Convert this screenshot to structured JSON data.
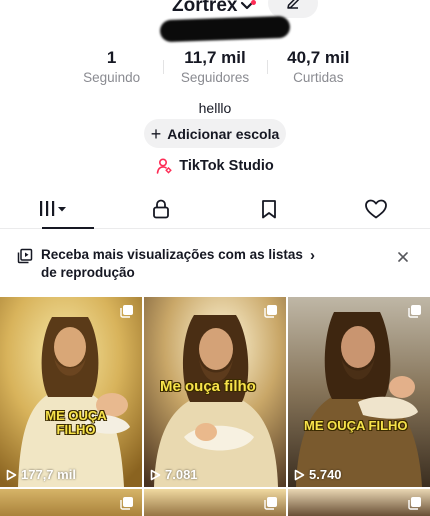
{
  "profile": {
    "username": "Zortrex",
    "bio": "helllo",
    "add_school_label": "Adicionar escola",
    "studio_label": "TikTok Studio"
  },
  "stats": [
    {
      "value": "1",
      "label": "Seguindo"
    },
    {
      "value": "11,7 mil",
      "label": "Seguidores"
    },
    {
      "value": "40,7 mil",
      "label": "Curtidas"
    }
  ],
  "tabs": [
    {
      "name": "videos",
      "icon": "grid-icon",
      "active": true
    },
    {
      "name": "private",
      "icon": "lock-icon"
    },
    {
      "name": "saved",
      "icon": "bookmark-icon"
    },
    {
      "name": "liked",
      "icon": "heart-icon"
    }
  ],
  "banner": {
    "text": "Receba mais visualizações com as listas de reprodução",
    "chevron": "›",
    "close": "×"
  },
  "videos": [
    {
      "views": "177,7 mil",
      "caption": "ME OUÇA FILHO"
    },
    {
      "views": "7.081",
      "caption": "Me ouça filho"
    },
    {
      "views": "5.740",
      "caption": "ME OUÇA FILHO"
    }
  ],
  "colors": {
    "accent": "#fe2c55",
    "text": "#161823",
    "muted": "#8a8b91",
    "chip_bg": "#f1f1f2",
    "caption_yellow": "#f7e34a"
  }
}
